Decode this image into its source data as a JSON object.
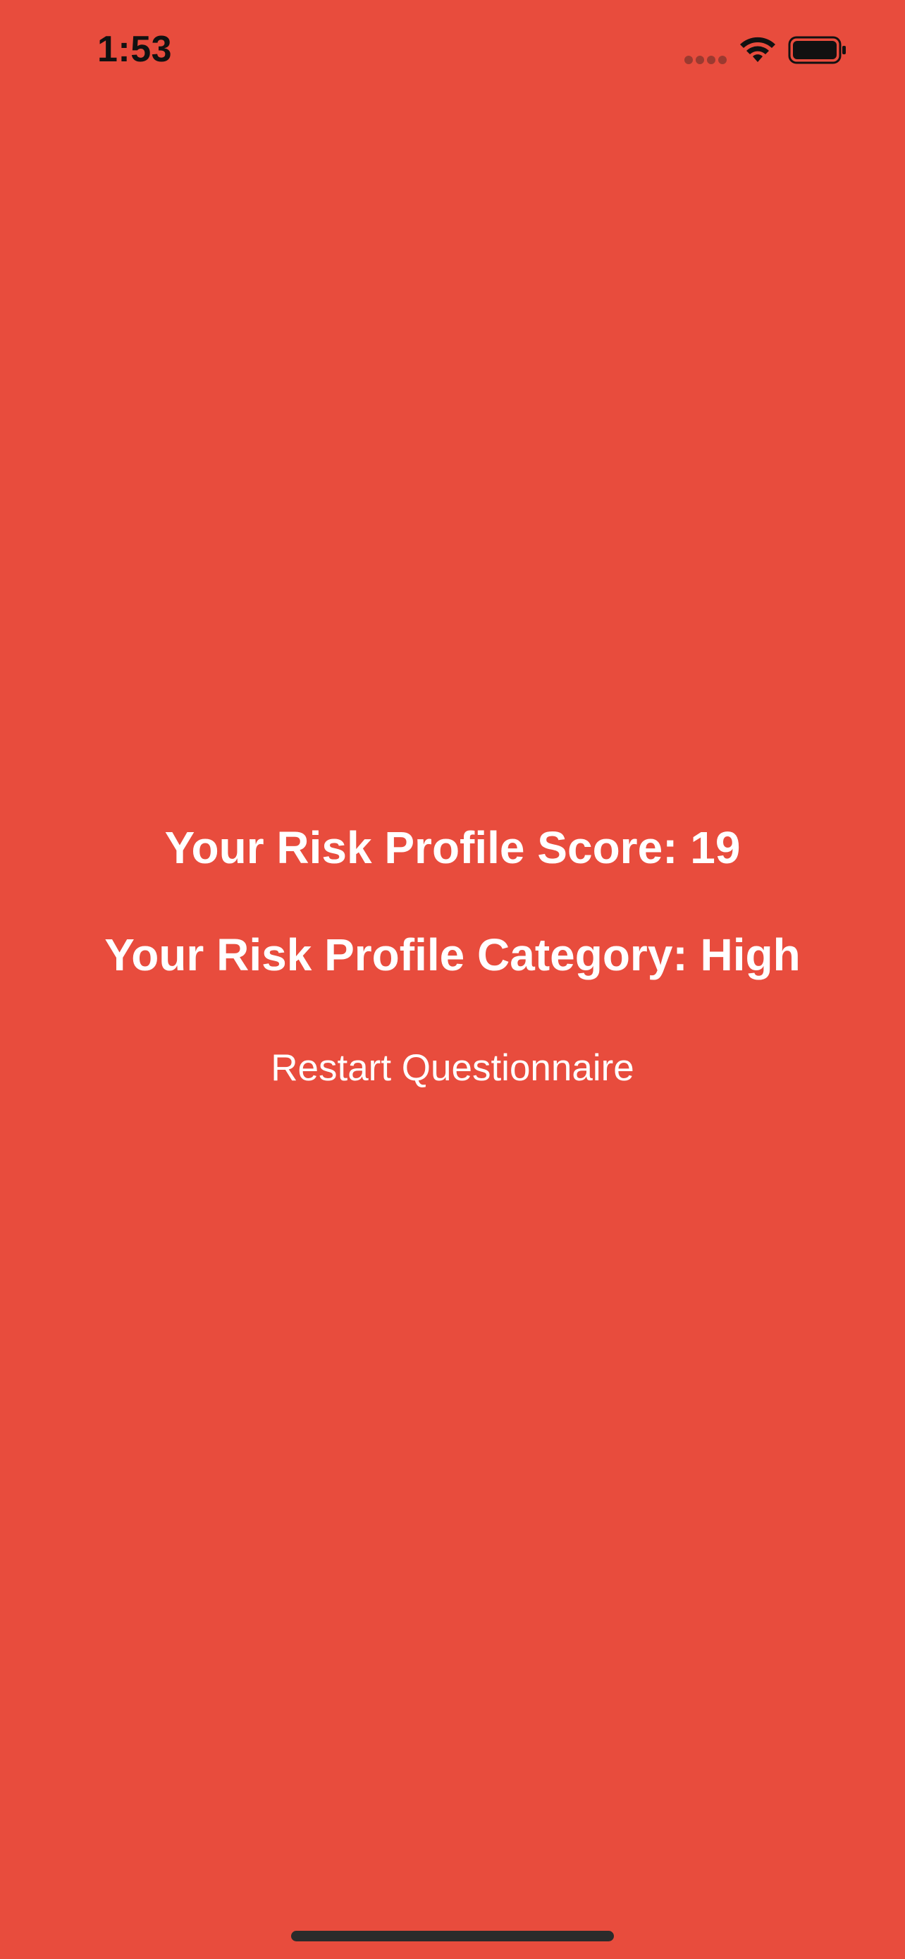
{
  "status_bar": {
    "time": "1:53",
    "icons": [
      "signal-dots-icon",
      "wifi-icon",
      "battery-icon"
    ]
  },
  "result": {
    "score_text": "Your Risk Profile Score: 19",
    "category_text": "Your Risk Profile Category: High"
  },
  "actions": {
    "restart_label": "Restart Questionnaire"
  },
  "colors": {
    "background": "#E84C3D",
    "text": "#FFFFFF",
    "status_text": "#111111"
  }
}
